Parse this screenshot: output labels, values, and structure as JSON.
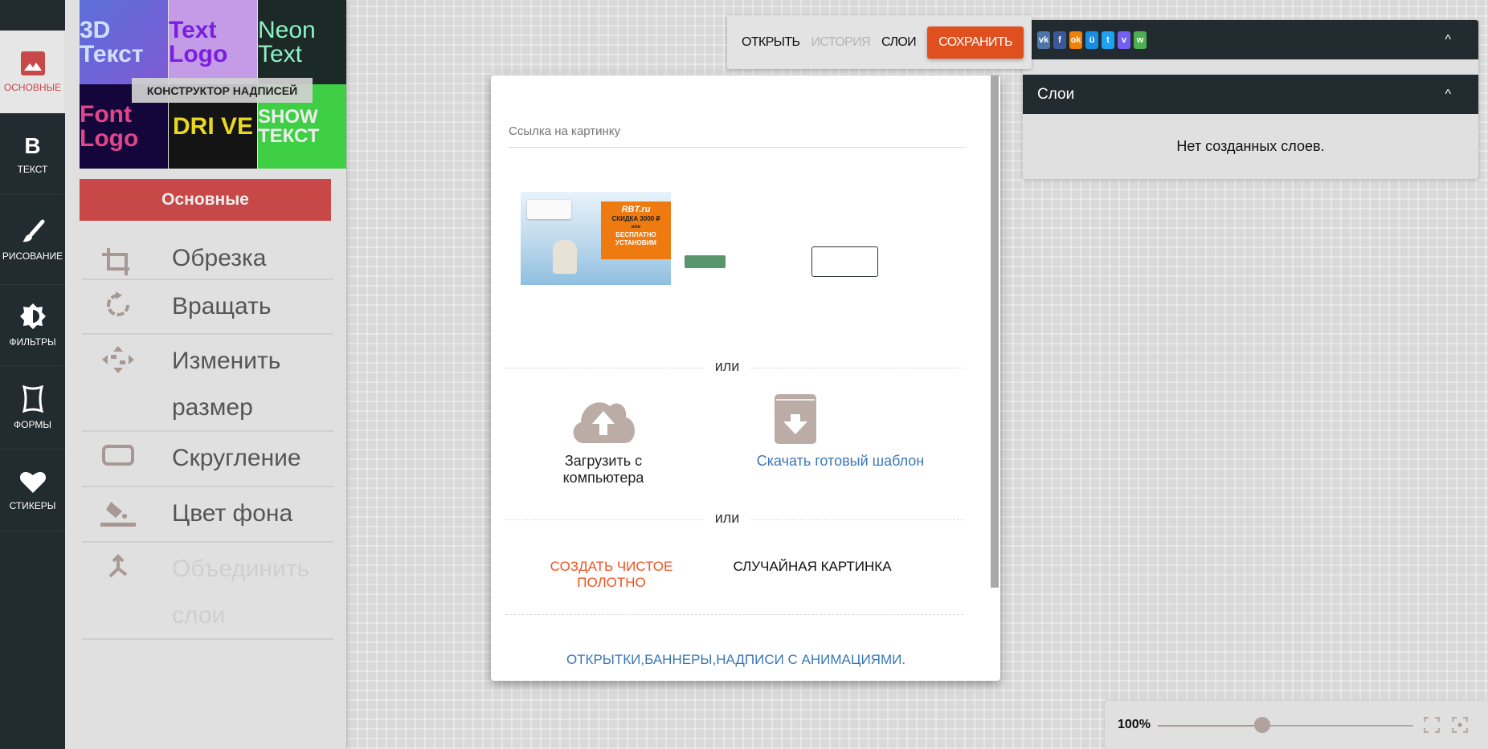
{
  "nav": {
    "items": [
      {
        "label": "ОСНОВНЫЕ",
        "icon": "image-icon",
        "active": true
      },
      {
        "label": "ТЕКСТ",
        "icon": "text-b-icon"
      },
      {
        "label": "РИСОВАНИЕ",
        "icon": "brush-icon"
      },
      {
        "label": "ФИЛЬТРЫ",
        "icon": "filter-icon"
      },
      {
        "label": "ФОРМЫ",
        "icon": "shape-icon"
      },
      {
        "label": "СТИКЕРЫ",
        "icon": "heart-icon"
      }
    ]
  },
  "panel": {
    "thumbs": [
      {
        "text": "3D Текст"
      },
      {
        "text": "Text Logo"
      },
      {
        "text": "Neon Text"
      },
      {
        "text": "Font Logo"
      },
      {
        "text": "DRI VE"
      },
      {
        "text": "SHOW ТЕКСТ"
      }
    ],
    "tooltip": "КОНСТРУКТОР НАДПИСЕЙ",
    "section_button": "Основные",
    "menu": [
      {
        "label": "Обрезка",
        "icon": "crop-icon"
      },
      {
        "label": "Вращать",
        "icon": "rotate-icon"
      },
      {
        "label": "Изменить размер",
        "icon": "resize-icon"
      },
      {
        "label": "Скругление",
        "icon": "rounded-rect-icon"
      },
      {
        "label": "Цвет фона",
        "icon": "paint-bucket-icon"
      },
      {
        "label": "Объединить слои",
        "icon": "merge-icon",
        "disabled": true
      }
    ]
  },
  "toolbar": {
    "open": "ОТКРЫТЬ",
    "history": "ИСТОРИЯ",
    "layers": "СЛОИ",
    "save": "СОХРАНИТЬ"
  },
  "right_panel": {
    "social": [
      {
        "name": "vk",
        "label": "vk",
        "color": "#4a76a8"
      },
      {
        "name": "facebook",
        "label": "f",
        "color": "#3b5998"
      },
      {
        "name": "odnoklassniki",
        "label": "ok",
        "color": "#ee8208"
      },
      {
        "name": "moimir",
        "label": "ü",
        "color": "#168de2"
      },
      {
        "name": "twitter",
        "label": "t",
        "color": "#1da1f2"
      },
      {
        "name": "viber",
        "label": "v",
        "color": "#7360f2"
      },
      {
        "name": "whatsapp",
        "label": "w",
        "color": "#4caf50"
      }
    ],
    "layers_title": "Слои",
    "layers_empty": "Нет созданных слоев."
  },
  "dialog": {
    "url_placeholder": "Ссылка на картинку",
    "banner": {
      "brand": "RBT.ru",
      "line1": "СКИДКА 3000 ₽",
      "or": "или",
      "line2": "БЕСПЛАТНО",
      "line3": "УСТАНОВИМ"
    },
    "or": "или",
    "upload": "Загрузить с компьютера",
    "download_template": "Скачать готовый шаблон",
    "create_blank": "СОЗДАТЬ ЧИСТОЕ ПОЛОТНО",
    "random_image": "СЛУЧАЙНАЯ КАРТИНКА",
    "footer_link": "ОТКРЫТКИ,БАННЕРЫ,НАДПИСИ С АНИМАЦИЯМИ."
  },
  "zoom": {
    "label": "100%",
    "slider_fraction": 0.41
  },
  "colors": {
    "accent": "#c84848",
    "save": "#e0501f",
    "link": "#3a78b8",
    "create": "#f4511e",
    "icon": "#bcaca6",
    "dark": "#222b30"
  }
}
